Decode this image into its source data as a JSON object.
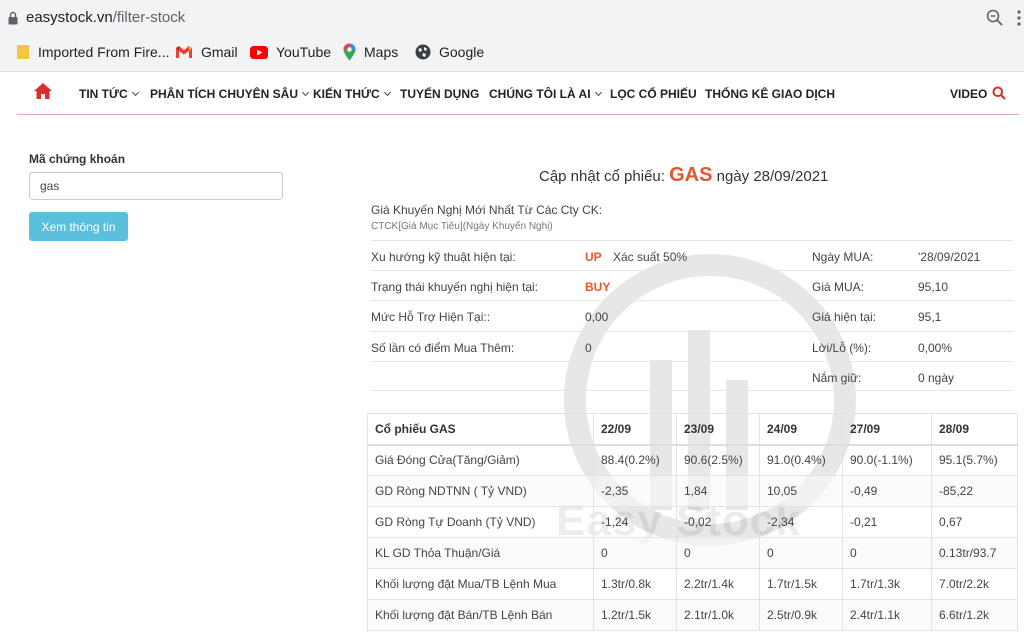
{
  "browser": {
    "url_host": "easystock.vn",
    "url_path": "/filter-stock",
    "bookmarks": [
      "Imported From Fire...",
      "Gmail",
      "YouTube",
      "Maps",
      "Google"
    ]
  },
  "nav": {
    "items": [
      {
        "label": "TIN TỨC",
        "dropdown": true
      },
      {
        "label": "PHÂN TÍCH CHUYÊN SÂU",
        "dropdown": true
      },
      {
        "label": "KIẾN THỨC",
        "dropdown": true
      },
      {
        "label": "TUYỂN DỤNG",
        "dropdown": false
      },
      {
        "label": "CHÚNG TÔI LÀ AI",
        "dropdown": true
      },
      {
        "label": "LỌC CỔ PHIẾU",
        "dropdown": false
      },
      {
        "label": "THỐNG KÊ GIAO DỊCH",
        "dropdown": false
      }
    ],
    "video": "VIDEO"
  },
  "form": {
    "label": "Mã chứng khoán",
    "value": "gas",
    "button": "Xem thông tin"
  },
  "heading": {
    "prefix": "Cập nhật cổ phiếu:",
    "ticker": "GAS",
    "suffix": "ngày 28/09/2021"
  },
  "recommend": {
    "title": "Giá Khuyến Nghị Mới Nhất Từ Các Cty CK:",
    "subtitle": "CTCK[Giá Mục Tiêu](Ngày Khuyến Nghị)"
  },
  "info": {
    "trend_label": "Xu hướng kỹ thuật hiện tại:",
    "trend_value": "UP",
    "trend_prob": "Xác suất 50%",
    "status_label": "Trạng thái khuyến nghị hiện tại:",
    "status_value": "BUY",
    "support_label": "Mức Hỗ Trợ Hiện Tại::",
    "support_value": "0,00",
    "addbuy_label": "Số lần có điểm Mua Thêm:",
    "addbuy_value": "0",
    "buy_date_label": "Ngày MUA:",
    "buy_date_value": "'28/09/2021",
    "buy_price_label": "Giá MUA:",
    "buy_price_value": "95,10",
    "cur_price_label": "Giá hiện tại:",
    "cur_price_value": "95,1",
    "pl_label": "Lời/Lỗ (%):",
    "pl_value": "0,00%",
    "hold_label": "Nắm giữ:",
    "hold_value": "0 ngày"
  },
  "watermark": "Easy Stock",
  "table": {
    "headers": [
      "Cổ phiếu GAS",
      "22/09",
      "23/09",
      "24/09",
      "27/09",
      "28/09"
    ],
    "rows": [
      [
        "Giá Đóng Cửa(Tăng/Giảm)",
        "88.4(0.2%)",
        "90.6(2.5%)",
        "91.0(0.4%)",
        "90.0(-1.1%)",
        "95.1(5.7%)"
      ],
      [
        "GD Ròng NDTNN ( Tỷ VND)",
        "-2,35",
        "1,84",
        "10,05",
        "-0,49",
        "-85,22"
      ],
      [
        "GD Ròng Tự Doanh (Tỷ VND)",
        "-1,24",
        "-0,02",
        "-2,34",
        "-0,21",
        "0,67"
      ],
      [
        "KL GD Thỏa Thuận/Giá",
        "0",
        "0",
        "0",
        "0",
        "0.13tr/93.7"
      ],
      [
        "Khối lượng đặt Mua/TB Lệnh Mua",
        "1.3tr/0.8k",
        "2.2tr/1.4k",
        "1.7tr/1.5k",
        "1.7tr/1.3k",
        "7.0tr/2.2k"
      ],
      [
        "Khối lượng đặt Bán/TB Lệnh Bán",
        "1.2tr/1.5k",
        "2.1tr/1.0k",
        "2.5tr/0.9k",
        "2.4tr/1.1k",
        "6.6tr/1.2k"
      ]
    ]
  }
}
